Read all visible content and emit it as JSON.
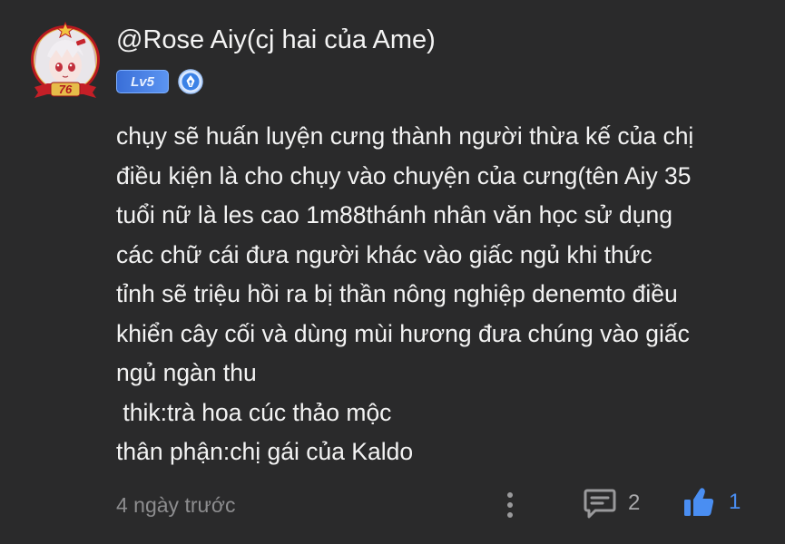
{
  "comment": {
    "username": "@Rose Aiy(cj hai của Ame)",
    "level_badge": "Lv5",
    "avatar_number": "76",
    "lines": [
      "chụy sẽ huấn luyện cưng thành người thừa kế của chị",
      "điều kiện là cho chụy vào chuyện của cưng(tên Aiy 35",
      "tuổi nữ là les cao 1m88thánh nhân văn học sử dụng",
      "các chữ cái đưa người khác vào giấc ngủ khi thức",
      "tỉnh sẽ triệu hồi ra bị thần nông nghiệp denemto điều",
      "khiển cây cối và dùng mùi hương đưa chúng vào giấc",
      "ngủ ngàn thu",
      " thik:trà hoa cúc thảo mộc",
      "thân phận:chị gái của Kaldo"
    ],
    "timestamp": "4 ngày trước",
    "reply_count": "2",
    "like_count": "1"
  },
  "colors": {
    "background": "#2a2a2b",
    "text": "#f3f3f3",
    "muted": "#8d8d8f",
    "accent": "#4a8ef2",
    "level_badge": "#4a82e6"
  },
  "icons": {
    "verify": "verified-pen-icon",
    "more": "vertical-dots-icon",
    "reply": "comment-bubble-icon",
    "like": "thumbs-up-icon"
  }
}
